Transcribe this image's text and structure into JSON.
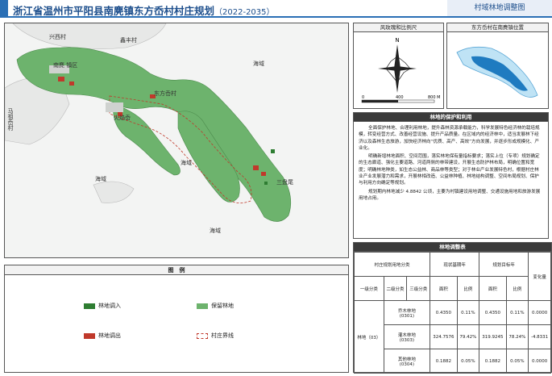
{
  "header": {
    "title": "浙江省温州市平阳县南麂镇东方岙村村庄规划",
    "period": "（2022-2035）",
    "map_title": "村域林地调整图"
  },
  "map": {
    "labels": {
      "xinan": "兴西村",
      "haike": "鑫丰村",
      "nanji_zhen": "南麂 镇区",
      "mazu": "马祖岙村",
      "dongfang": "东方岙村",
      "huoyan": "火焰岙",
      "sanpan": "三盘尾",
      "haiyu1": "海域",
      "haiyu2": "海域",
      "haiyu3": "海域",
      "haiyu4": "海域"
    }
  },
  "compass": {
    "title": "风玫瑰和比例尺",
    "north": "N",
    "scale_ticks": [
      "0",
      "400",
      "800 M"
    ]
  },
  "location": {
    "title": "东方岙村在南麂镇位置"
  },
  "protection": {
    "title": "林地的保护和利用",
    "para1": "全面保护林地、合理利用林地，提升森林资源承载能力，科学发展特色经济林的栽培规模，转变经营方式、改善经营设施、提升产品质量。在区域内的经济林中，适当发展林下经济以及森林生态旅游，加快经济林向“优质、高产、高效”方向发展，并逐步形成规模化、产业化。",
    "para2": "明确新增林地面积、空间范围，落实林地保有量指标要求；落实上位（专项）规划确定的生态廊道、强化主要道路、河道两侧的林带建设，开展生态防护林布局，明确位置和宽度；明确林地种类，如生态公益林、商品林等类型；对于林业产业发展特色村，根据村庄林业产业发展潜力和需求，开展林相改造、公益林种植、林地结构调整、空间布局规划、保护与利用方向确定等规划。",
    "para3": "规划期内林地减少 4.8842 公顷，主要为村镇建设用地调整、交通设施用地和旅游发展用地占用。"
  },
  "table": {
    "title": "林地调整表",
    "headers": {
      "category": "村庄规划用地分类",
      "current": "现状基期年",
      "target": "规划目标年",
      "change": "变化量",
      "level1": "一级分类",
      "level2": "二级分类",
      "level3": "三级分类",
      "area": "面积",
      "ratio": "比例"
    },
    "level1_value": "林地（03）",
    "rows": [
      {
        "name": "乔木林地",
        "code": "(0301)",
        "cur_area": "0.4350",
        "cur_ratio": "0.11%",
        "tgt_area": "0.4350",
        "tgt_ratio": "0.11%",
        "change": "0.0000"
      },
      {
        "name": "灌木林地",
        "code": "(0303)",
        "cur_area": "324.7576",
        "cur_ratio": "79.42%",
        "tgt_area": "319.9245",
        "tgt_ratio": "78.24%",
        "change": "-4.8331"
      },
      {
        "name": "其他林地",
        "code": "(0304)",
        "cur_area": "0.1882",
        "cur_ratio": "0.05%",
        "tgt_area": "0.1882",
        "tgt_ratio": "0.05%",
        "change": "0.0000"
      }
    ]
  },
  "legend": {
    "title": "图　例",
    "items": {
      "forest_in": "林地调入",
      "forest_keep": "保留林地",
      "forest_out": "林地调出",
      "village_boundary": "村庄界线"
    },
    "colors": {
      "forest_in": "#2e7d32",
      "forest_keep": "#6db36d",
      "forest_out": "#c0392b",
      "sea": "#f3f4f3",
      "title": "#1c4e8c"
    }
  }
}
